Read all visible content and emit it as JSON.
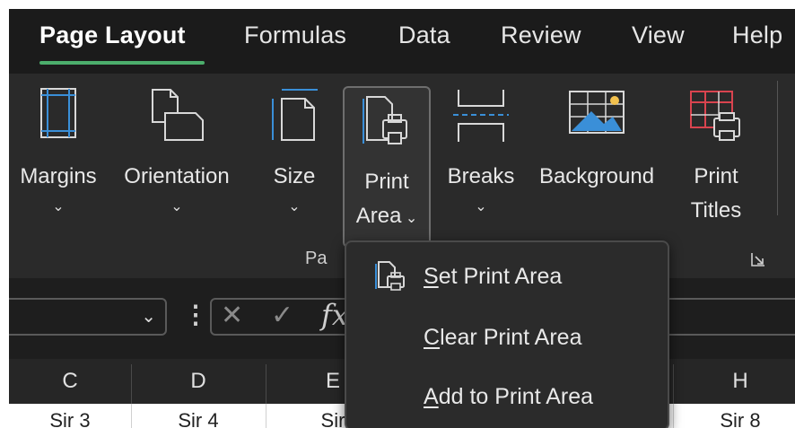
{
  "tabs": [
    {
      "label": "Page Layout",
      "active": true
    },
    {
      "label": "Formulas"
    },
    {
      "label": "Data"
    },
    {
      "label": "Review"
    },
    {
      "label": "View"
    },
    {
      "label": "Help"
    }
  ],
  "ribbon": {
    "margins": {
      "label": "Margins",
      "icon": "margins-icon"
    },
    "orientation": {
      "label": "Orientation",
      "icon": "orientation-icon"
    },
    "size": {
      "label": "Size",
      "icon": "size-icon"
    },
    "print_area": {
      "line1": "Print",
      "line2": "Area",
      "icon": "print-area-icon",
      "selected": true
    },
    "breaks": {
      "label": "Breaks",
      "icon": "breaks-icon"
    },
    "background": {
      "label": "Background",
      "icon": "background-icon"
    },
    "print_titles": {
      "line1": "Print",
      "line2": "Titles",
      "icon": "print-titles-icon"
    },
    "group_label_visible": "Pa"
  },
  "menu": {
    "items": [
      {
        "label_underline": "S",
        "label_rest": "et Print Area",
        "icon": "set-print-area-icon"
      },
      {
        "label_underline": "C",
        "label_rest": "lear Print Area"
      },
      {
        "label_underline": "A",
        "label_rest": "dd to Print Area"
      }
    ]
  },
  "formula_bar": {
    "fx_label": "fx"
  },
  "columns": [
    "C",
    "D",
    "E",
    "H"
  ],
  "cells": [
    "Sir 3",
    "Sir 4",
    "Sir",
    "Sir 8"
  ],
  "colors": {
    "accent_green": "#4cae6c",
    "ribbon_bg": "#2a2a2a",
    "icon_blue": "#3a8fd8",
    "icon_red": "#d9444f"
  }
}
